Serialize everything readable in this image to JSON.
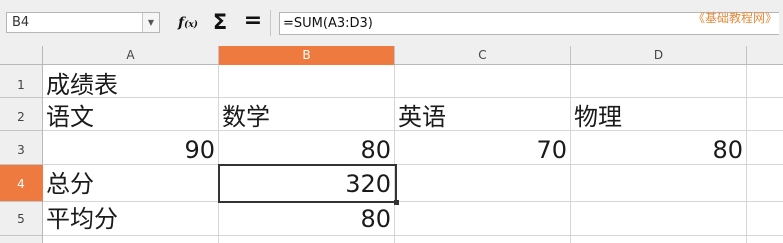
{
  "formula_bar": {
    "name_box": "B4",
    "function_wizard_icon": "fx-icon",
    "sum_icon": "sigma-icon",
    "formula_icon": "equals-icon",
    "formula": "=SUM(A3:D3)",
    "watermark": "《基础教程网》"
  },
  "columns": [
    "A",
    "B",
    "C",
    "D"
  ],
  "active_column": "B",
  "rows": [
    "1",
    "2",
    "3",
    "4",
    "5"
  ],
  "active_row": "4",
  "cells": {
    "A1": "成绩表",
    "A2": "语文",
    "B2": "数学",
    "C2": "英语",
    "D2": "物理",
    "A3": "90",
    "B3": "80",
    "C3": "70",
    "D3": "80",
    "A4": "总分",
    "B4": "320",
    "A5": "平均分",
    "B5": "80"
  },
  "selected_cell": "B4",
  "colors": {
    "accent": "#ee7a3f",
    "header_bg": "#efefef",
    "watermark": "#e38a3a"
  }
}
